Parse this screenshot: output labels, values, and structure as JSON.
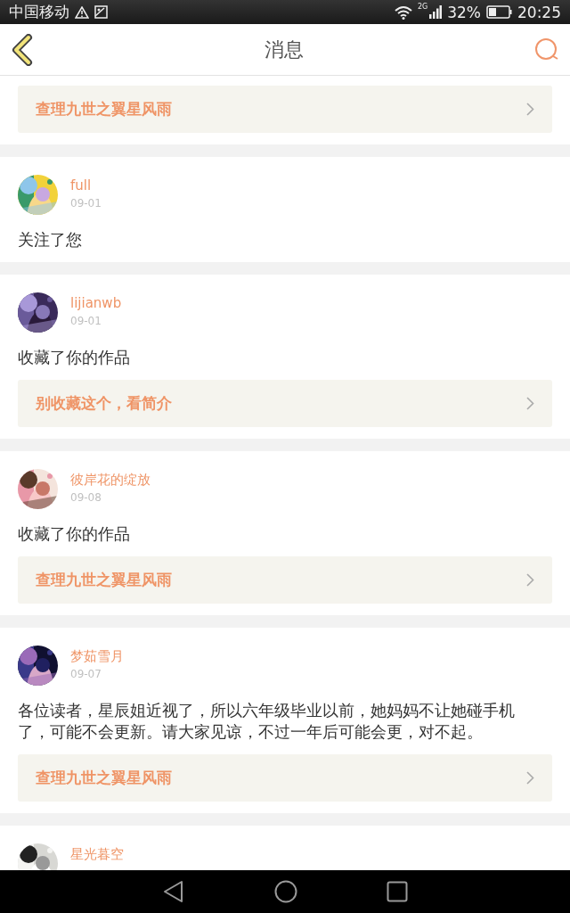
{
  "status_bar": {
    "carrier": "中国移动",
    "network": "2G",
    "battery": "32%",
    "time": "20:25"
  },
  "header": {
    "title": "消息"
  },
  "messages": [
    {
      "link": "查理九世之翼星风雨"
    },
    {
      "user": "full",
      "date": "09-01",
      "text": "关注了您"
    },
    {
      "user": "lijianwb",
      "date": "09-01",
      "text": "收藏了你的作品",
      "link": "别收藏这个，看简介"
    },
    {
      "user": "彼岸花的绽放",
      "date": "09-08",
      "text": "收藏了你的作品",
      "link": "查理九世之翼星风雨"
    },
    {
      "user": "梦茹雪月",
      "date": "09-07",
      "text": "各位读者，星辰姐近视了，所以六年级毕业以前，她妈妈不让她碰手机了，可能不会更新。请大家见谅，不过一年后可能会更，对不起。",
      "link": "查理九世之翼星风雨"
    },
    {
      "user": "星光暮空"
    }
  ]
}
